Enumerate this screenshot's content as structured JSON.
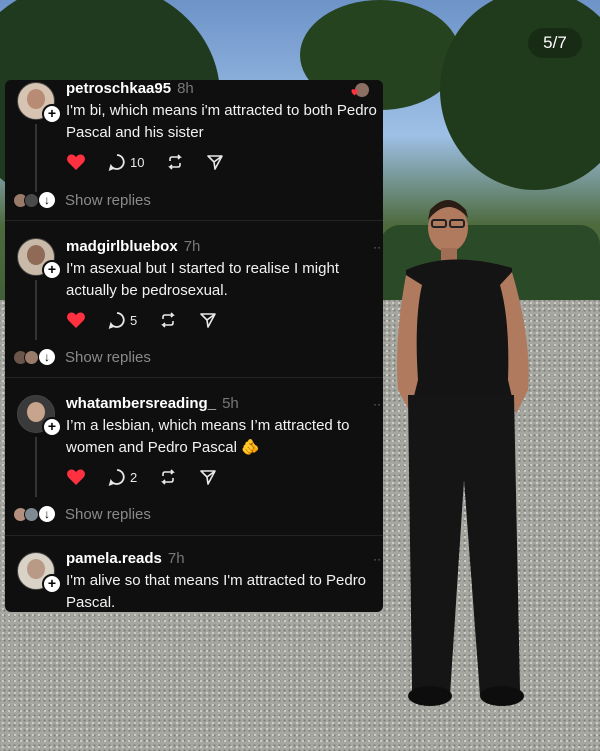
{
  "story": {
    "counter": "5/7"
  },
  "comments": [
    {
      "username": "petroschkaa95",
      "time": "8h",
      "text": "I'm bi, which means i'm attracted to both Pedro Pascal and his sister",
      "replies_count": "10",
      "show_replies": "Show replies",
      "emoji": ""
    },
    {
      "username": "madgirlbluebox",
      "time": "7h",
      "text": "I'm asexual but I started to realise I might actually be pedrosexual.",
      "replies_count": "5",
      "show_replies": "Show replies",
      "emoji": ""
    },
    {
      "username": "whatambersreading_",
      "time": "5h",
      "text": "I’m a lesbian, which means I’m attracted to women and Pedro Pascal",
      "replies_count": "2",
      "show_replies": "Show replies",
      "emoji": "🫵"
    },
    {
      "username": "pamela.reads",
      "time": "7h",
      "text": "I'm alive so that means I'm attracted to Pedro Pascal.",
      "replies_count": "",
      "show_replies": "",
      "emoji": ""
    }
  ],
  "colors": {
    "heart": "#ff3040",
    "panel": "#0f0f10",
    "muted": "#8a8a8a"
  },
  "icons": [
    "heart-icon",
    "reply-bubble-icon",
    "repost-icon",
    "share-send-icon",
    "show-replies-arrow-icon",
    "plus-icon"
  ]
}
